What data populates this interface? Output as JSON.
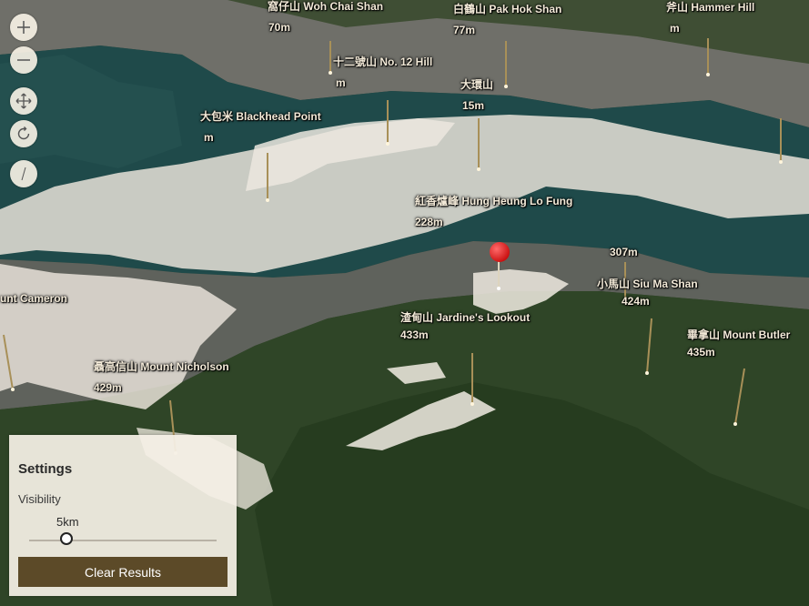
{
  "map": {
    "peaks": [
      {
        "id": "woh-chai-shan",
        "name": "窩仔山 Woh Chai Shan",
        "elevation": "70m"
      },
      {
        "id": "pak-hok-shan",
        "name": "白鶴山 Pak Hok Shan",
        "elevation": "77m"
      },
      {
        "id": "hammer-hill",
        "name": "斧山 Hammer Hill",
        "elevation": "m"
      },
      {
        "id": "no-12-hill",
        "name": "十二號山 No. 12 Hill",
        "elevation": "m"
      },
      {
        "id": "tai-wan-shan",
        "name": "大環山",
        "elevation": "15m"
      },
      {
        "id": "blackhead-point",
        "name": "大包米 Blackhead Point",
        "elevation": "m"
      },
      {
        "id": "hung-heung-lo-fung",
        "name": "紅香爐峰 Hung Heung Lo Fung",
        "elevation": "228m"
      },
      {
        "id": "mount-cameron",
        "name": "unt Cameron",
        "elevation": ""
      },
      {
        "id": "peak-307",
        "name": "",
        "elevation": "307m"
      },
      {
        "id": "siu-ma-shan",
        "name": "小馬山 Siu Ma Shan",
        "elevation": "424m"
      },
      {
        "id": "jardines-lookout",
        "name": "渣甸山 Jardine's Lookout",
        "elevation": "433m"
      },
      {
        "id": "mount-butler",
        "name": "畢拿山 Mount Butler",
        "elevation": "435m"
      },
      {
        "id": "mount-nicholson",
        "name": "聶高信山 Mount Nicholson",
        "elevation": "429m"
      }
    ]
  },
  "controls": {
    "zoom_in_icon": "plus-icon",
    "zoom_out_icon": "minus-icon",
    "pan_icon": "move-arrows-icon",
    "rotate_icon": "rotate-icon",
    "compass_icon": "compass-icon"
  },
  "settings": {
    "title": "Settings",
    "visibility_label": "Visibility",
    "slider_value": "5km",
    "slider_fraction": 0.2,
    "clear_button": "Clear Results",
    "button_color": "#5c4a28"
  },
  "colors": {
    "water": "#1f4a4a",
    "visible_area": "#e7e2d8",
    "marker": "#e01818"
  }
}
